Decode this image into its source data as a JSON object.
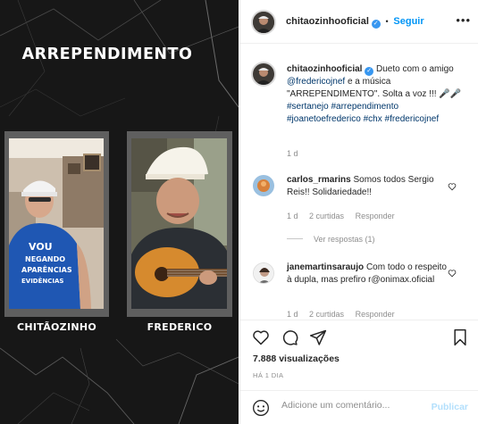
{
  "media": {
    "title": "ARREPENDIMENTO",
    "left_caption": "CHITÃOZINHO",
    "right_caption": "FREDERICO",
    "left_shirt_text": "VOU NEGANDO AS APARÊNCIAS DISFARÇANDO AS EVIDÊNCIAS"
  },
  "header": {
    "username": "chitaozinhooficial",
    "separator": "•",
    "follow_label": "Seguir",
    "more_label": "•••"
  },
  "post": {
    "username": "chitaozinhooficial",
    "text_1": "Dueto com o amigo ",
    "mention": "@fredericojnef",
    "text_2": " e a música \"ARREPENDIMENTO\". Solta a voz !!! 🎤🎤 ",
    "hashtags": "#sertanejo #arrependimento #joanetoefrederico #chx #fredericojnef",
    "time": "1 d"
  },
  "comments": [
    {
      "username": "carlos_rmarins",
      "text": "Somos todos Sergio Reis!! Solidariedade!!",
      "time": "1 d",
      "likes": "2 curtidas",
      "reply": "Responder",
      "view_replies": "Ver respostas (1)"
    },
    {
      "username": "janemartinsaraujo",
      "text": "Com todo o respeito à dupla, mas prefiro r@onimax.oficial",
      "time": "1 d",
      "likes": "2 curtidas",
      "reply": "Responder"
    }
  ],
  "stats": {
    "views": "7.888 visualizações",
    "ago": "HÁ 1 DIA"
  },
  "composer": {
    "placeholder": "Adicione um comentário...",
    "publish_label": "Publicar"
  }
}
